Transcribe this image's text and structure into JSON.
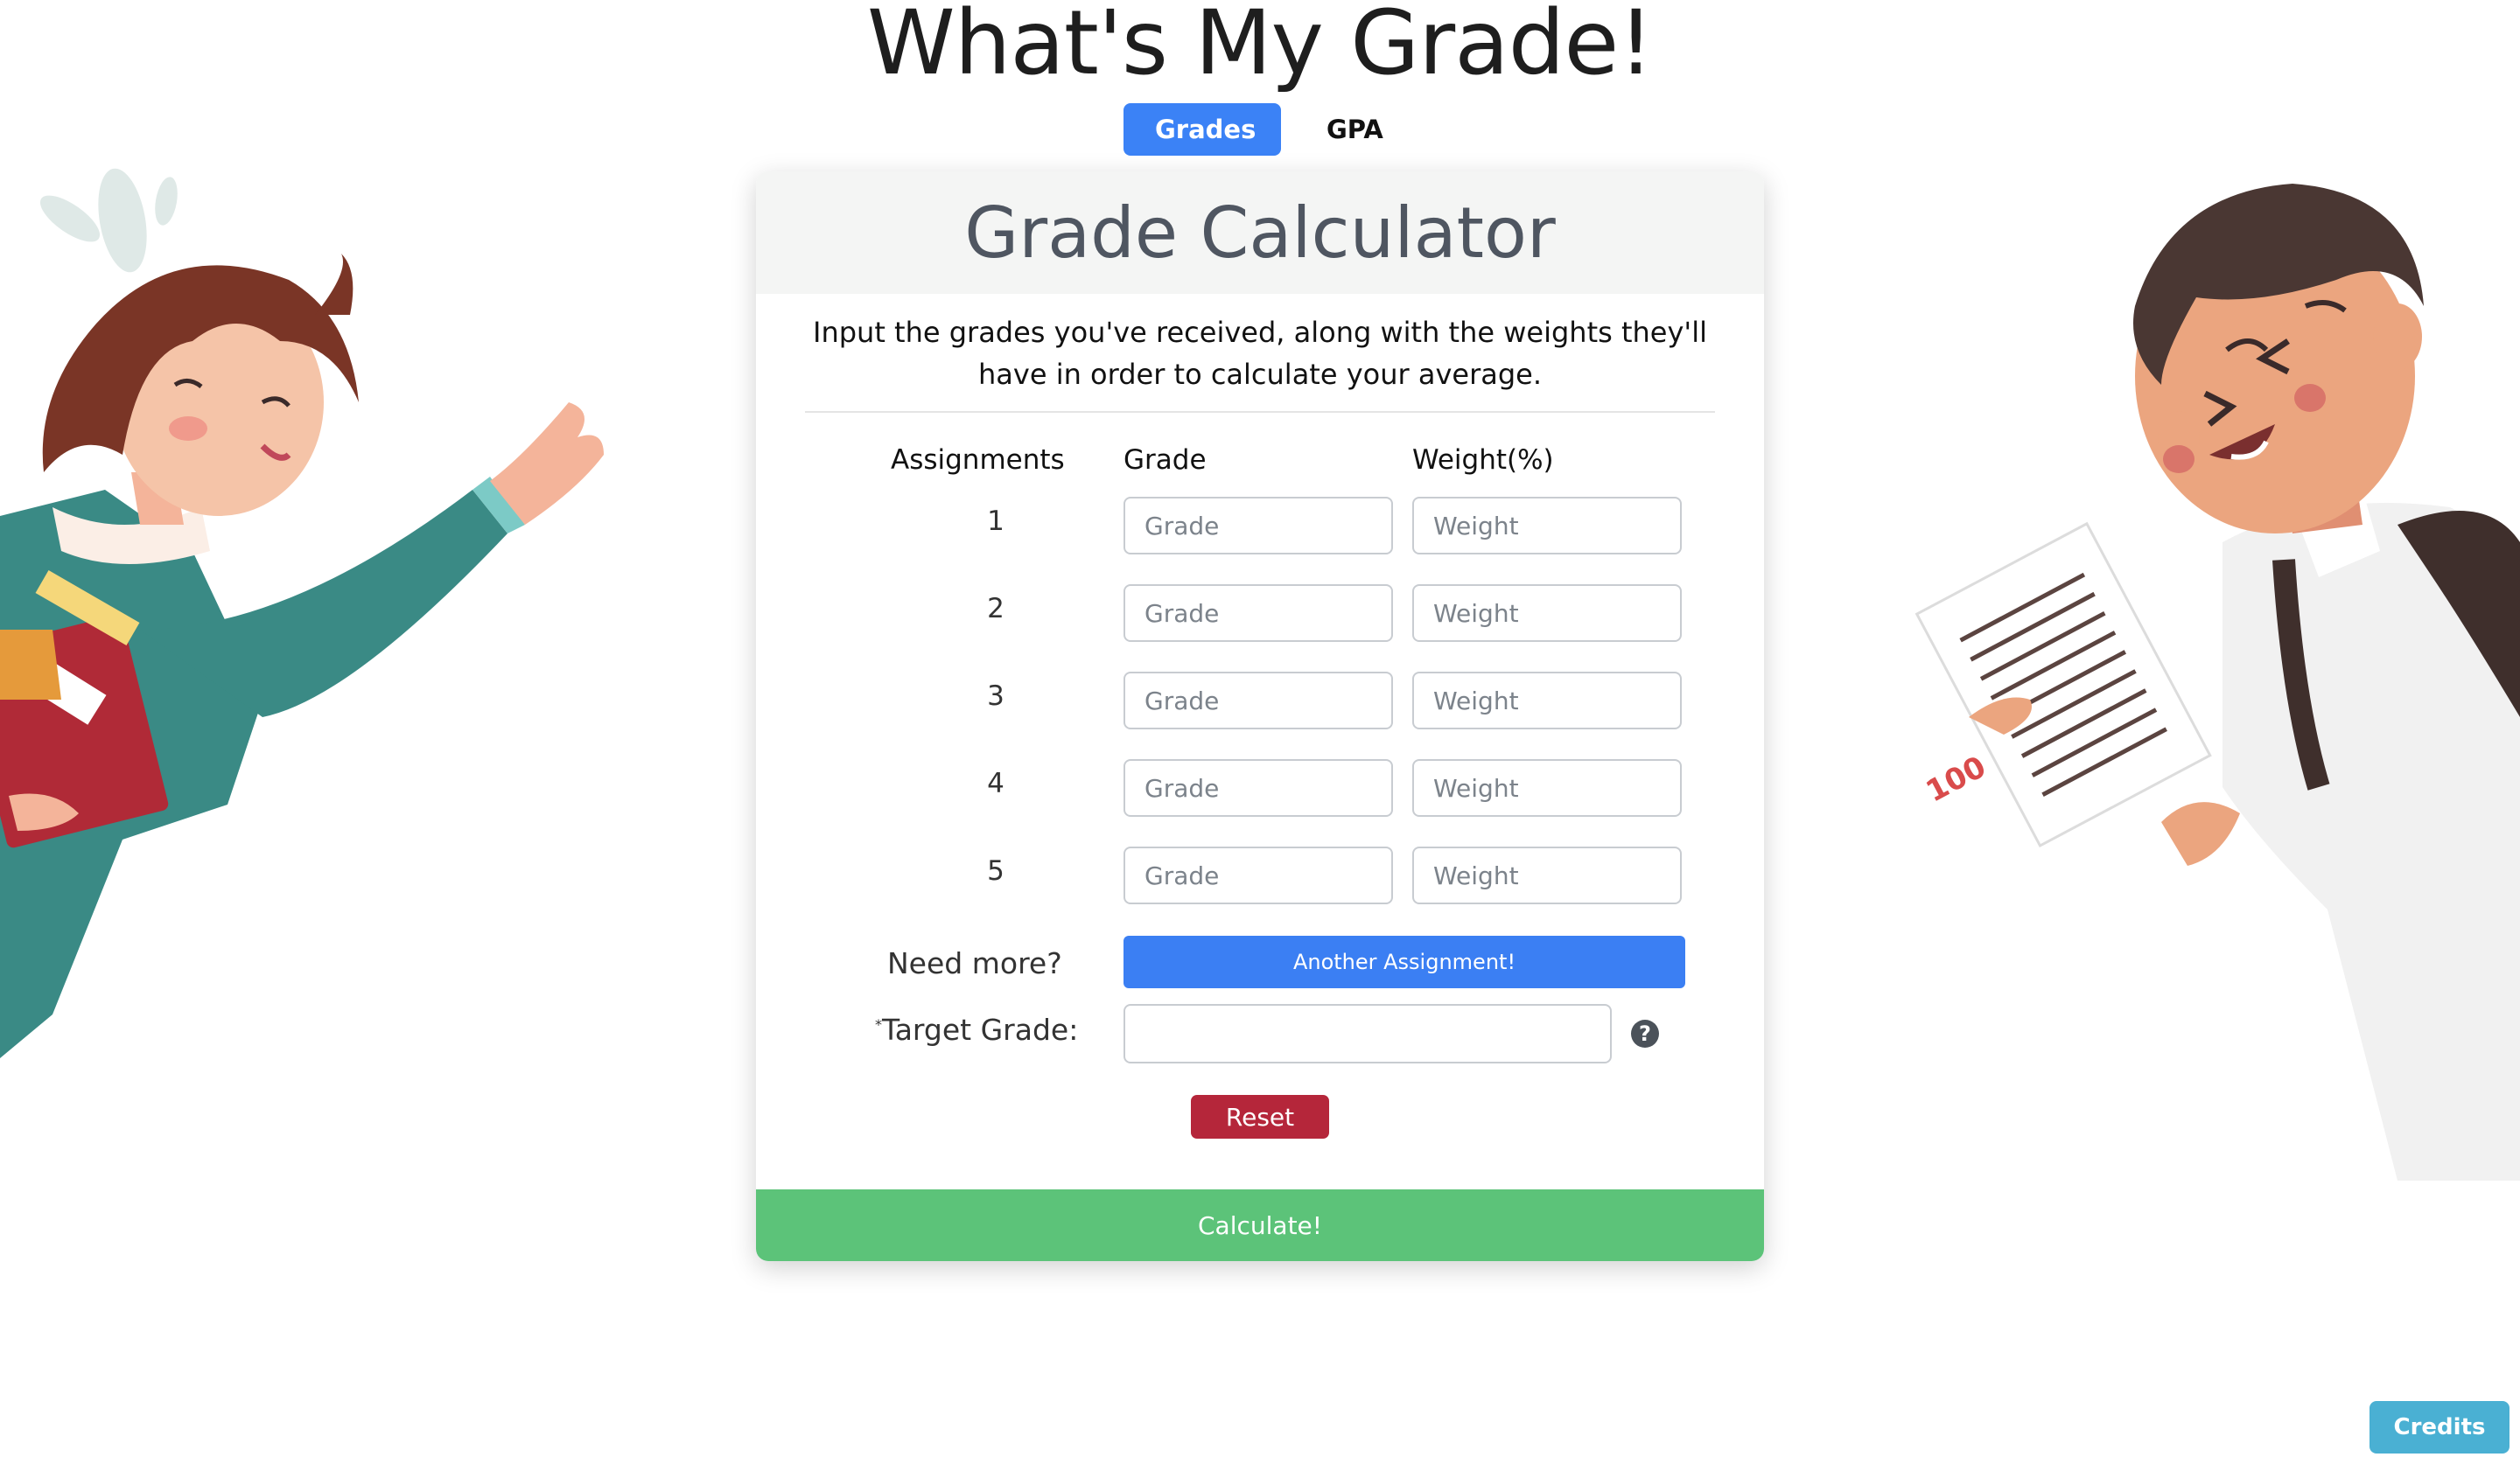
{
  "site": {
    "title": "What's My Grade!"
  },
  "nav": {
    "tabs": [
      {
        "label": "Grades",
        "active": true
      },
      {
        "label": "GPA",
        "active": false
      }
    ]
  },
  "card": {
    "title": "Grade Calculator",
    "intro": "Input the grades you've received, along with the weights they'll have in order to calculate your average.",
    "columns": {
      "assignments": "Assignments",
      "grade": "Grade",
      "weight": "Weight(%)"
    },
    "rows": [
      {
        "number": "1",
        "grade_placeholder": "Grade",
        "weight_placeholder": "Weight",
        "grade": "",
        "weight": ""
      },
      {
        "number": "2",
        "grade_placeholder": "Grade",
        "weight_placeholder": "Weight",
        "grade": "",
        "weight": ""
      },
      {
        "number": "3",
        "grade_placeholder": "Grade",
        "weight_placeholder": "Weight",
        "grade": "",
        "weight": ""
      },
      {
        "number": "4",
        "grade_placeholder": "Grade",
        "weight_placeholder": "Weight",
        "grade": "",
        "weight": ""
      },
      {
        "number": "5",
        "grade_placeholder": "Grade",
        "weight_placeholder": "Weight",
        "grade": "",
        "weight": ""
      }
    ],
    "need_more_label": "Need more?",
    "another_button": "Another Assignment!",
    "target_asterisk": "*",
    "target_label": "Target Grade:",
    "target_value": "",
    "help_icon": "question-circle-icon",
    "reset_button": "Reset",
    "calculate_button": "Calculate!"
  },
  "footer": {
    "credits_button": "Credits"
  },
  "illustrations": {
    "left": "student-girl-with-books",
    "right": "student-boy-with-test-paper",
    "test_score": "100"
  },
  "colors": {
    "primary": "#3b7ff3",
    "danger": "#b5263a",
    "success": "#5cc379",
    "info": "#4ab0d3"
  }
}
